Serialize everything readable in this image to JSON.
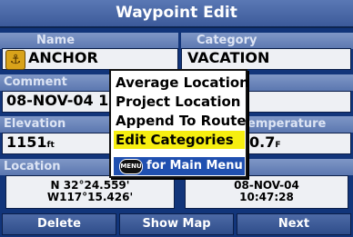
{
  "header": {
    "title": "Waypoint Edit"
  },
  "fields": {
    "name": {
      "label": "Name",
      "value": "ANCHOR",
      "icon": "anchor-icon"
    },
    "category": {
      "label": "Category",
      "value": "VACATION"
    },
    "comment": {
      "label": "Comment",
      "value": "08-NOV-04 1"
    },
    "elevation": {
      "label": "Elevation",
      "value": "1151",
      "unit": "ft"
    },
    "temperature": {
      "label": "emperature",
      "value": "0.7",
      "unit": "F"
    },
    "location": {
      "label": "Location",
      "lat": "N  32°24.559'",
      "lon": "W117°15.426'"
    },
    "datetime": {
      "date": "08-NOV-04",
      "time": "10:47:28"
    }
  },
  "bottom_buttons": {
    "delete": "Delete",
    "show_map": "Show Map",
    "next": "Next"
  },
  "menu": {
    "items": [
      {
        "label": "Average Location",
        "selected": false
      },
      {
        "label": "Project Location",
        "selected": false
      },
      {
        "label": "Append To Route",
        "selected": false
      },
      {
        "label": "Edit Categories",
        "selected": true
      }
    ],
    "footer": {
      "key_label": "MENU",
      "text": "for Main Menu"
    }
  },
  "colors": {
    "background": "#12357a",
    "title_bar": "#4a68a8",
    "selection": "#f6ee10",
    "footer": "#2050b0"
  }
}
